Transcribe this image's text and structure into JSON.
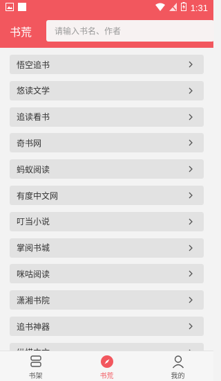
{
  "status_bar": {
    "time": "1:31"
  },
  "header": {
    "title": "书荒",
    "search_placeholder": "请输入书名、作者"
  },
  "list": [
    "悟空追书",
    "悠读文学",
    "追读看书",
    "奇书网",
    "蚂蚁阅读",
    "有度中文网",
    "叮当小说",
    "掌阅书城",
    "咪咕阅读",
    "潇湘书院",
    "追书神器",
    "纵横中文"
  ],
  "tabs": [
    {
      "label": "书架"
    },
    {
      "label": "书荒"
    },
    {
      "label": "我的"
    }
  ],
  "colors": {
    "accent": "#f2575e"
  }
}
